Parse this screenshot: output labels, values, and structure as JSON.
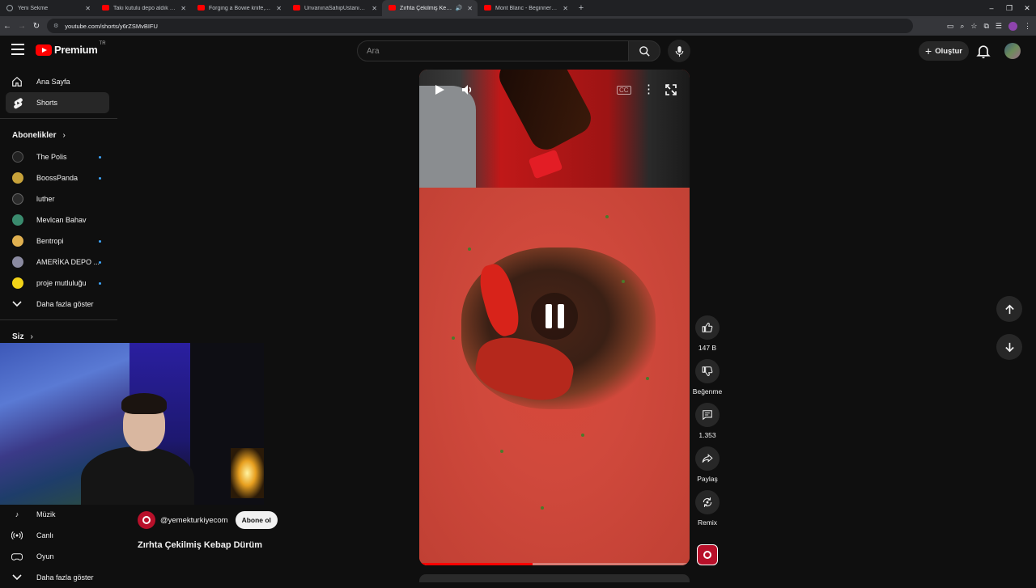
{
  "browser": {
    "tabs": [
      {
        "title": "Yeni Sekme",
        "icon": "globe-icon"
      },
      {
        "title": "Takı kutulu depo aldık - YouTube",
        "icon": "youtube-favicon"
      },
      {
        "title": "Forging a Bowie knife, the com",
        "icon": "youtube-favicon"
      },
      {
        "title": "ÜnvanınaSahipUstanınYaptığı",
        "icon": "youtube-favicon"
      },
      {
        "title": "Zırhta Çekilmiş Kebap Dürü",
        "icon": "youtube-favicon",
        "active": true
      },
      {
        "title": "Mont Blanc - Beginner climb",
        "icon": "youtube-favicon"
      }
    ],
    "url": "youtube.com/shorts/y6rZSMvBIFU"
  },
  "header": {
    "logo_text": "Premium",
    "region": "TR",
    "search_placeholder": "Ara",
    "create_label": "Oluştur"
  },
  "sidebar": {
    "main": [
      {
        "label": "Ana Sayfa",
        "icon": "home-icon"
      },
      {
        "label": "Shorts",
        "icon": "shorts-icon",
        "active": true
      }
    ],
    "subs_header": "Abonelikler",
    "subs": [
      {
        "label": "The Polis",
        "color": "#222222",
        "new": true
      },
      {
        "label": "BoossPanda",
        "color": "#c7a23a",
        "new": true
      },
      {
        "label": "luther",
        "color": "#2b2b2b",
        "new": false
      },
      {
        "label": "Mevlcan Bahav",
        "color": "#3a8b6e",
        "new": false
      },
      {
        "label": "Bentropi",
        "color": "#e0b050",
        "new": true
      },
      {
        "label": "AMERİKA DEPO ...",
        "color": "#8a8aa0",
        "new": true
      },
      {
        "label": "proje mutluluğu",
        "color": "#f2d318",
        "new": true
      }
    ],
    "show_more": "Daha fazla göster",
    "you_header": "Siz",
    "explore": [
      {
        "label": "Müzik",
        "icon": "music-icon"
      },
      {
        "label": "Canlı",
        "icon": "live-icon"
      },
      {
        "label": "Oyun",
        "icon": "gaming-icon"
      }
    ],
    "show_more_2": "Daha fazla göster"
  },
  "short": {
    "channel": "@yemekturkiyecom",
    "subscribe_label": "Abone ol",
    "title": "Zırhta Çekilmiş Kebap Dürüm",
    "progress": 0.42,
    "actions": {
      "like_count": "147 B",
      "dislike_label": "Beğenme",
      "comment_count": "1.353",
      "share_label": "Paylaş",
      "remix_label": "Remix"
    }
  },
  "colors": {
    "brand_red": "#ff0000",
    "background": "#0f0f0f",
    "accent_blue": "#3ea6ff"
  }
}
